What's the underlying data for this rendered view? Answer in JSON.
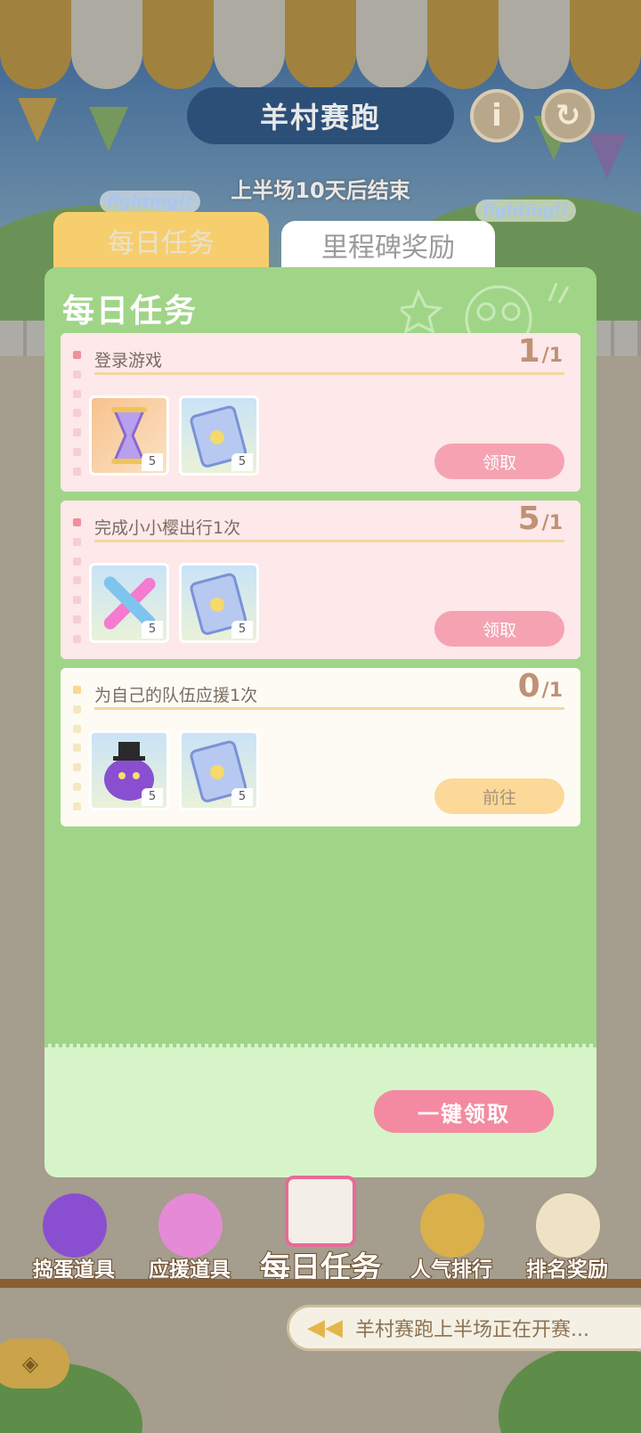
{
  "header": {
    "title": "羊村赛跑",
    "subtitle": "上半场10天后结束",
    "info_icon": "info-icon",
    "refresh_icon": "refresh-icon",
    "fighting_left": "fighting!!",
    "fighting_right": "fighting!!"
  },
  "tabs": [
    {
      "label": "每日任务",
      "active": true
    },
    {
      "label": "里程碑奖励",
      "active": false
    }
  ],
  "panel": {
    "title": "每日任务",
    "tasks": [
      {
        "name": "登录游戏",
        "progress": "1",
        "total": "/1",
        "items": [
          {
            "icon": "hourglass-icon",
            "count": "5"
          },
          {
            "icon": "ticket-card-icon",
            "count": "5"
          }
        ],
        "button": "领取"
      },
      {
        "name": "完成小小樱出行1次",
        "progress": "5",
        "total": "/1",
        "items": [
          {
            "icon": "glowsticks-icon",
            "count": "5"
          },
          {
            "icon": "ticket-card-icon",
            "count": "5"
          }
        ],
        "button": "领取"
      },
      {
        "name": "为自己的队伍应援1次",
        "progress": "0",
        "total": "/1",
        "items": [
          {
            "icon": "purple-monster-icon",
            "count": "5"
          },
          {
            "icon": "ticket-card-icon",
            "count": "5"
          }
        ],
        "button": "前往"
      }
    ],
    "claim_all": "一键领取"
  },
  "nav": [
    {
      "label": "捣蛋道具",
      "icon": "monster-icon"
    },
    {
      "label": "应援道具",
      "icon": "glowsticks-icon"
    },
    {
      "label": "每日任务",
      "icon": "notebook-icon"
    },
    {
      "label": "人气排行",
      "icon": "trophy-icon"
    },
    {
      "label": "排名奖励",
      "icon": "egg-face-icon"
    }
  ],
  "ticker": "羊村赛跑上半场正在开赛..."
}
